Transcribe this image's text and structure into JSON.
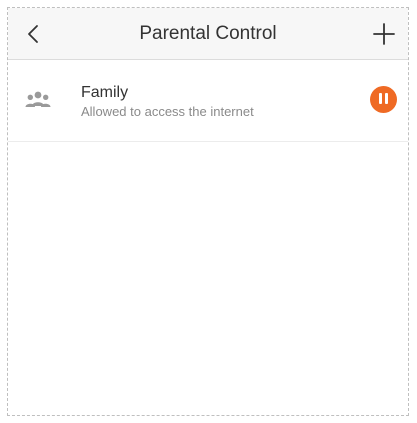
{
  "header": {
    "title": "Parental Control",
    "back_icon": "chevron-left-icon",
    "add_icon": "plus-icon"
  },
  "groups": [
    {
      "icon": "group-icon",
      "name": "Family",
      "status": "Allowed to access the internet",
      "action_icon": "pause-icon"
    }
  ],
  "colors": {
    "accent": "#ef6a24",
    "nav_background": "#f7f7f7",
    "subtitle_text": "#8a8a8a"
  }
}
